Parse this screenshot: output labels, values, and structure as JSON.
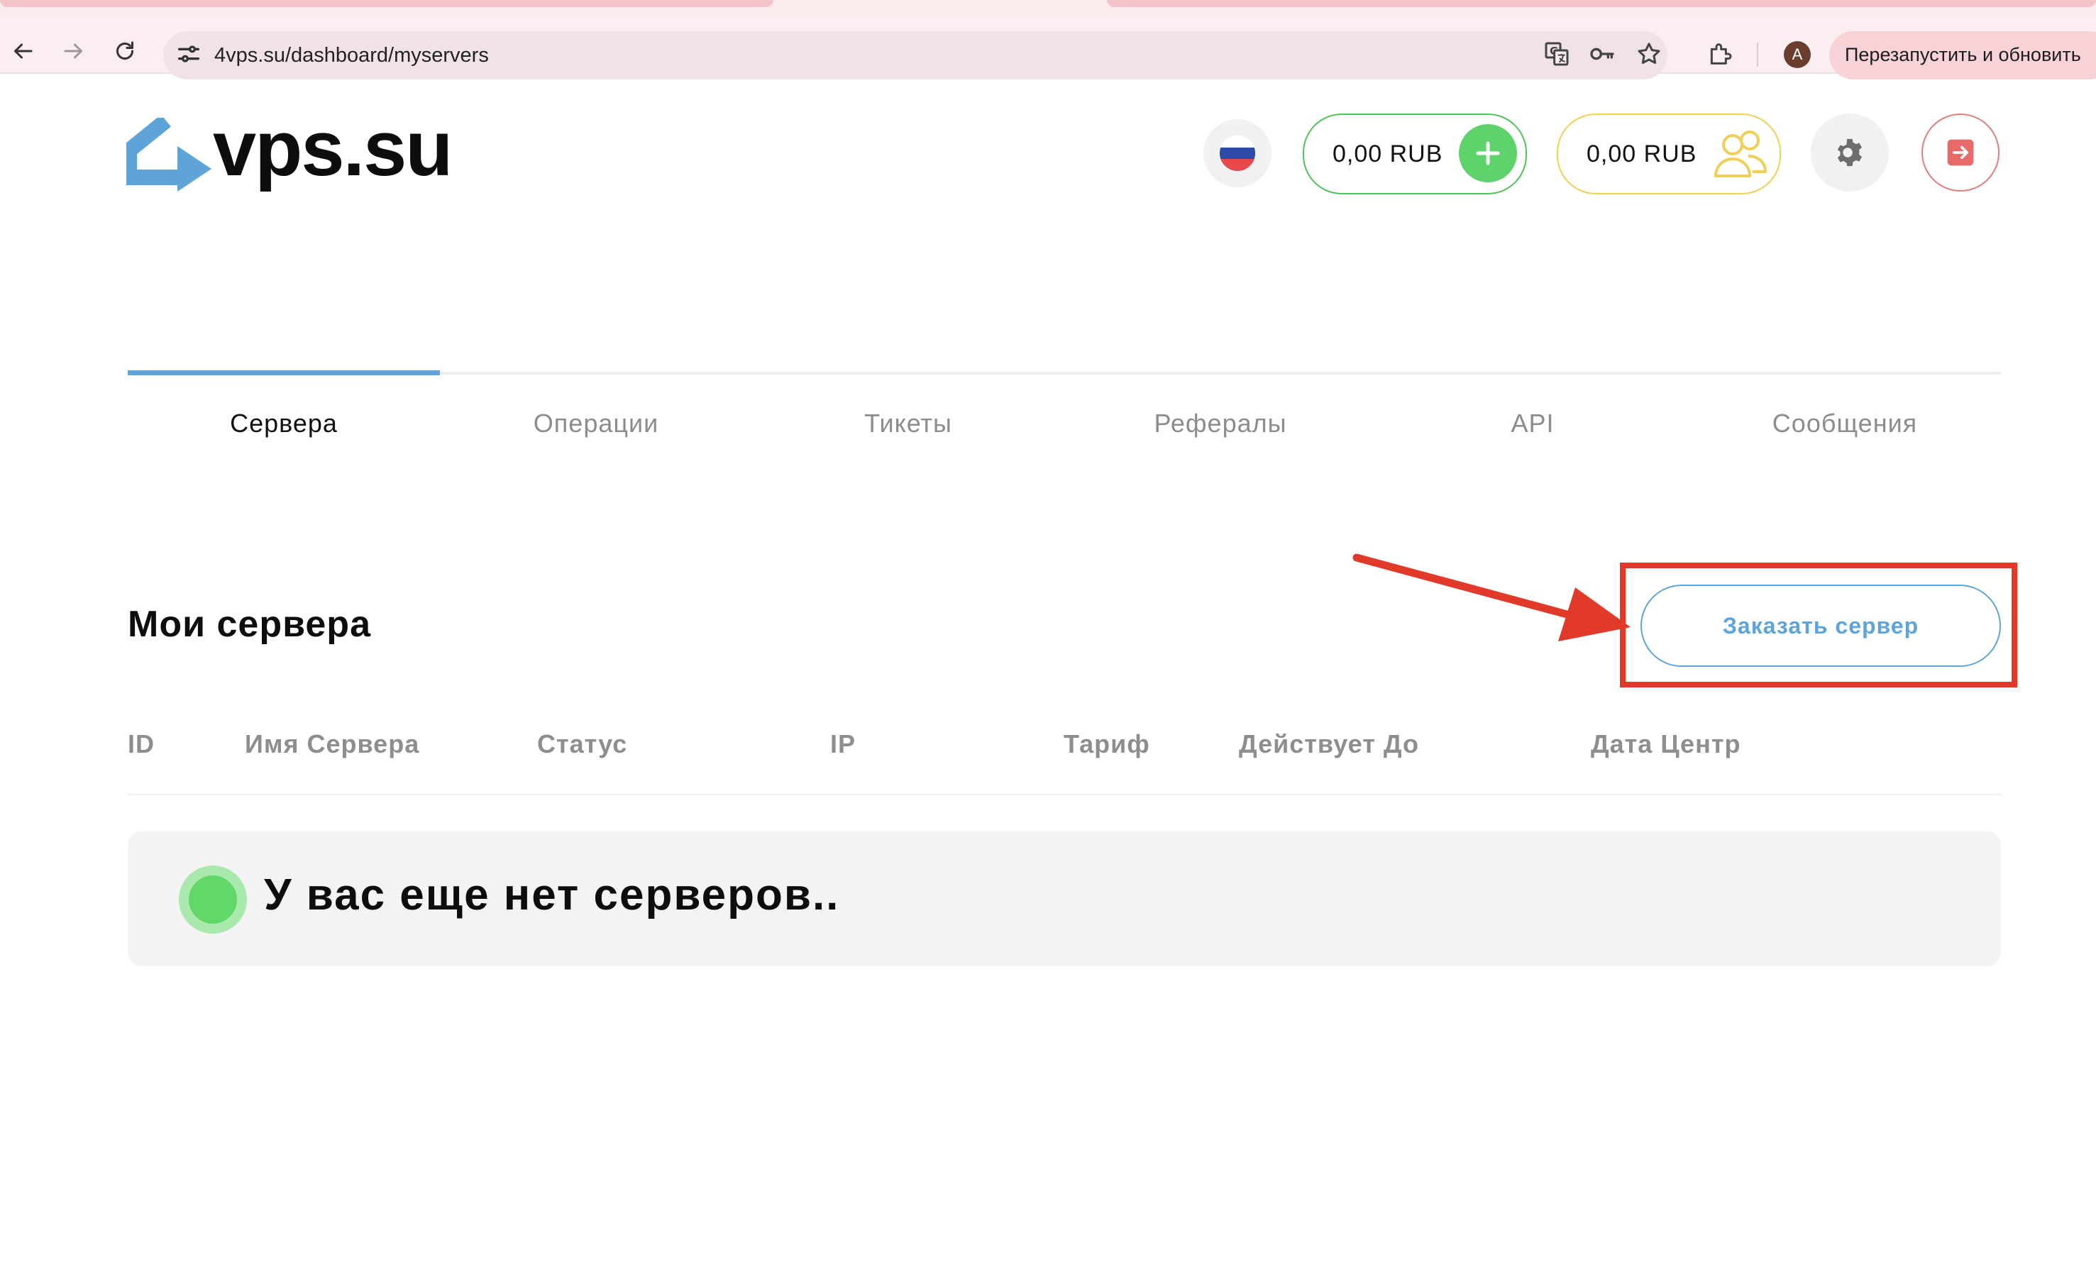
{
  "browser": {
    "url": "4vps.su/dashboard/myservers",
    "avatar_letter": "A",
    "relaunch_label": "Перезапустить и обновить"
  },
  "header": {
    "logo_text": "vps.su",
    "balance": "0,00 RUB",
    "referral_balance": "0,00 RUB"
  },
  "tabs": [
    {
      "label": "Сервера",
      "active": true
    },
    {
      "label": "Операции",
      "active": false
    },
    {
      "label": "Тикеты",
      "active": false
    },
    {
      "label": "Рефералы",
      "active": false
    },
    {
      "label": "API",
      "active": false
    },
    {
      "label": "Сообщения",
      "active": false
    }
  ],
  "main": {
    "title": "Мои сервера",
    "order_button": "Заказать сервер",
    "columns": [
      "ID",
      "Имя Сервера",
      "Статус",
      "IP",
      "Тариф",
      "Действует До",
      "Дата Центр"
    ],
    "empty_message": "У вас еще нет серверов.."
  },
  "colors": {
    "accent_blue": "#5fa4d8",
    "green": "#5fd36b",
    "yellow": "#f0cf57",
    "red_annotation": "#e23a2a"
  }
}
